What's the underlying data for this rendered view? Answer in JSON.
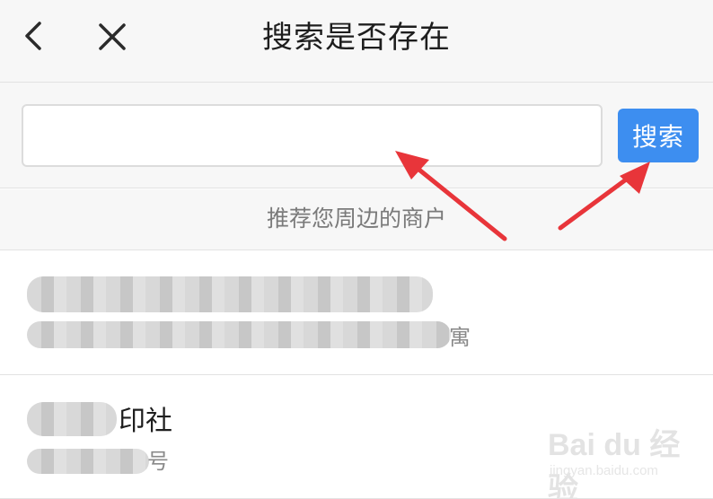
{
  "header": {
    "title": "搜索是否存在",
    "back_icon": "chevron-left-icon",
    "close_icon": "close-icon"
  },
  "search": {
    "value": "",
    "placeholder": "",
    "button_label": "搜索",
    "button_color": "#3d8ef0"
  },
  "section": {
    "title": "推荐您周边的商户"
  },
  "merchants": [
    {
      "name_visible": "",
      "address_visible": "寓"
    },
    {
      "name_visible": "印社",
      "address_visible": "号"
    }
  ],
  "annotation": {
    "arrow_color": "#e8353a"
  },
  "watermark": {
    "main": "Bai du 经验",
    "sub": "jingyan.baidu.com"
  }
}
